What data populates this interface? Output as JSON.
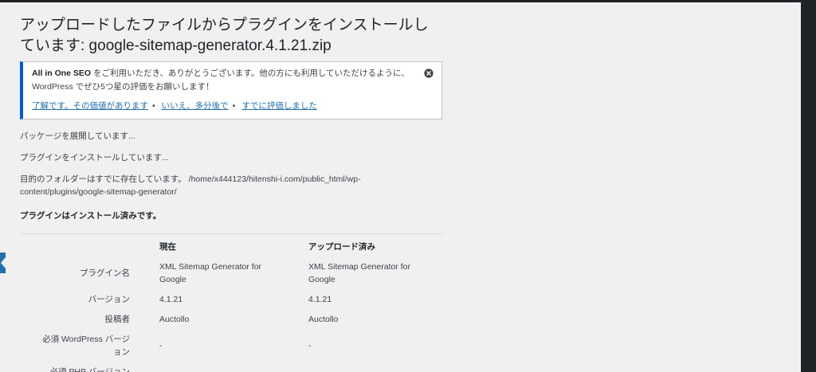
{
  "colors": {
    "background": "#f0f0f1",
    "text": "#3c434a",
    "heading": "#1d2327",
    "link": "#2271b1",
    "notice_accent": "#005ae0",
    "admin_menu_current": "#2271b1",
    "edge": "#1d2327"
  },
  "page": {
    "title": "アップロードしたファイルからプラグインをインストールしています: google-sitemap-generator.4.1.21.zip"
  },
  "notice": {
    "brand": "All in One SEO",
    "message_line1": "をご利用いただき、ありがとうございます。他の方にも利用していただけるように、",
    "message_line2": "WordPress でぜひ5つ星の評価をお願いします！",
    "links": [
      "了解です。その価値があります",
      "いいえ、多分後で",
      "すでに評価しました"
    ],
    "separator": "•",
    "dismiss_icon": "close-circle-icon"
  },
  "progress": {
    "unpacking": "パッケージを展開しています...",
    "installing": "プラグインをインストールしています...",
    "folder_exists_line1": "目的のフォルダーはすでに存在しています。 /home/x444123/hitenshi-i.com/public_html/wp-",
    "folder_exists_line2": "content/plugins/google-sitemap-generator/",
    "already_installed": "プラグインはインストール済みです。"
  },
  "comparison": {
    "headers": {
      "current": "現在",
      "uploaded": "アップロード済み"
    },
    "rows": [
      {
        "label": "プラグイン名",
        "current": "XML Sitemap Generator for Google",
        "uploaded": "XML Sitemap Generator for Google"
      },
      {
        "label": "バージョン",
        "current": "4.1.21",
        "uploaded": "4.1.21"
      },
      {
        "label": "投稿者",
        "current": "Auctollo",
        "uploaded": "Auctollo"
      },
      {
        "label": "必須 WordPress バージョン",
        "current": "-",
        "uploaded": "-"
      },
      {
        "label": "必須 PHP バージョン"
      }
    ]
  }
}
